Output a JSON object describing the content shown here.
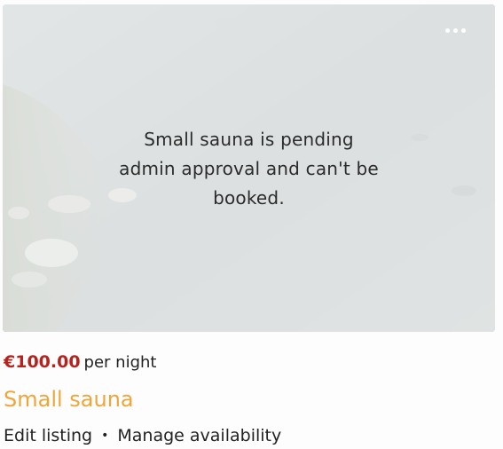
{
  "listing": {
    "pending_message": "Small sauna is pending admin approval and can't be booked.",
    "price": "€100.00",
    "price_unit": "per night",
    "title": "Small sauna",
    "menu_icon": "more-horizontal-icon"
  },
  "actions": {
    "edit_label": "Edit listing",
    "separator": "•",
    "availability_label": "Manage availability"
  },
  "colors": {
    "price": "#b5231f",
    "title": "#f0a53a"
  }
}
